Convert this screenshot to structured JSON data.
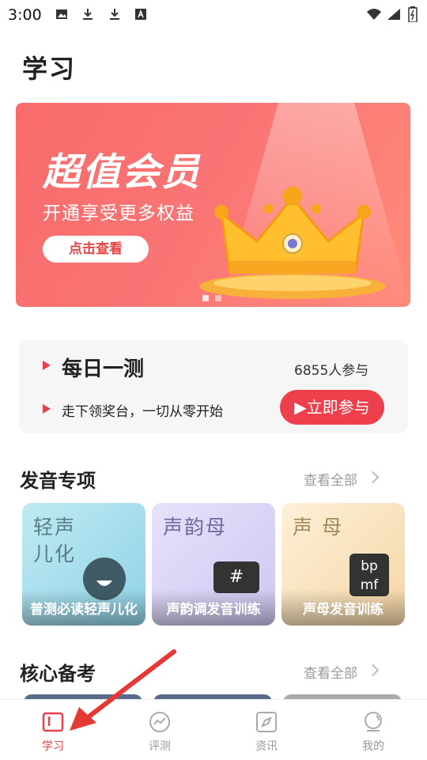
{
  "status_bar": {
    "time": "3:00"
  },
  "page": {
    "title": "学习"
  },
  "banner": {
    "headline": "超值会员",
    "subline": "开通享受更多权益",
    "button_label": "点击查看"
  },
  "daily": {
    "title": "每日一测",
    "participants": "6855人参与",
    "subtitle": "走下领奖台，一切从零开始",
    "join_label": "▶立即参与"
  },
  "pronunciation": {
    "section_title": "发音专项",
    "more_label": "查看全部",
    "tiles": [
      {
        "big": "轻声\n儿化",
        "caption": "普测必读轻声儿化"
      },
      {
        "big": "声韵母",
        "icon_text": "#",
        "caption": "声韵调发音训练"
      },
      {
        "big": "声 母",
        "icon_text": "bp\nmf",
        "caption": "声母发音训练"
      }
    ]
  },
  "core": {
    "section_title": "核心备考",
    "more_label": "查看全部"
  },
  "tabbar": {
    "items": [
      {
        "label": "学习",
        "icon": "book-icon",
        "active": true
      },
      {
        "label": "评测",
        "icon": "pulse-icon",
        "active": false
      },
      {
        "label": "资讯",
        "icon": "compass-icon",
        "active": false
      },
      {
        "label": "我的",
        "icon": "user-icon",
        "active": false
      }
    ]
  },
  "colors": {
    "accent": "#ee3f4d",
    "banner": "#f86b6b",
    "inactive": "#999999"
  }
}
